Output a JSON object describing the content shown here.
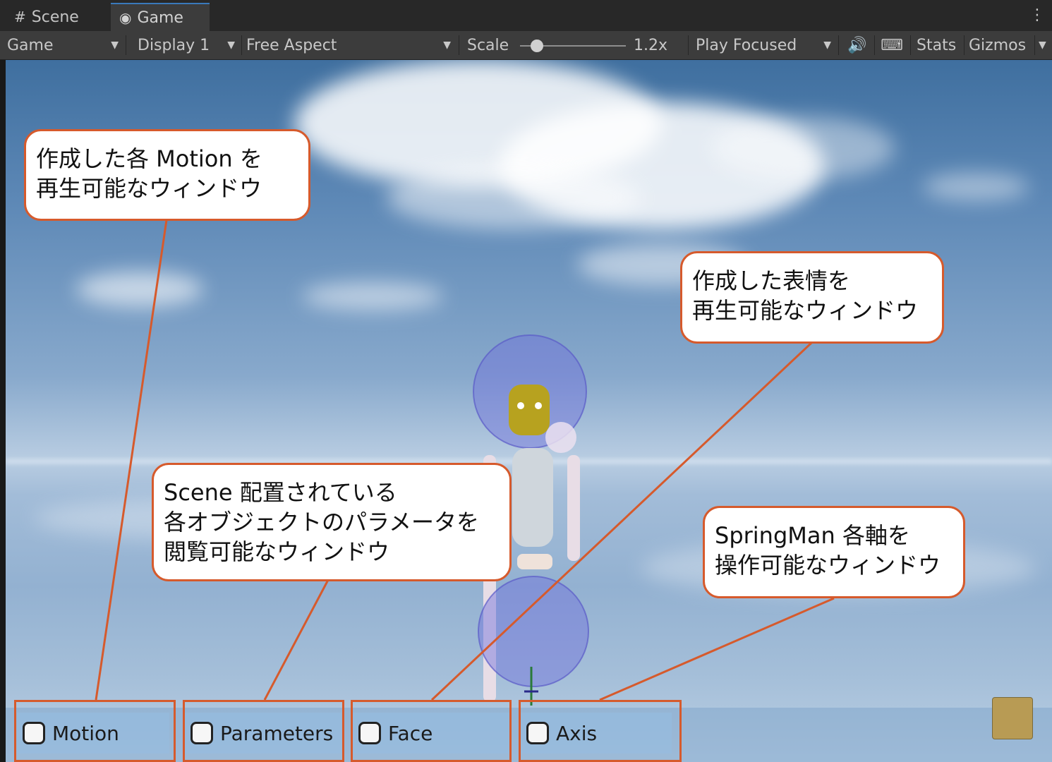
{
  "tabs": [
    {
      "label": "Scene",
      "icon": "grid-icon"
    },
    {
      "label": "Game",
      "icon": "gamepad-icon"
    }
  ],
  "toolbar": {
    "mode": "Game",
    "display": "Display 1",
    "aspect": "Free Aspect",
    "scale_label": "Scale",
    "scale_value": "1.2x",
    "play_mode": "Play Focused",
    "stats": "Stats",
    "gizmos": "Gizmos"
  },
  "callouts": {
    "motion": {
      "line1": "作成した各 Motion を",
      "line2": "再生可能なウィンドウ"
    },
    "face": {
      "line1": "作成した表情を",
      "line2": "再生可能なウィンドウ"
    },
    "parameters": {
      "line1": "Scene 配置されている",
      "line2": "各オブジェクトのパラメータを",
      "line3": "閲覧可能なウィンドウ"
    },
    "axis": {
      "line1": "SpringMan 各軸を",
      "line2": "操作可能なウィンドウ"
    }
  },
  "buttons": [
    "Motion",
    "Parameters",
    "Face",
    "Axis"
  ],
  "colors": {
    "accent": "#d65a2c",
    "toolbar": "#3c3c3c",
    "tab_active": "#3a79bb"
  }
}
